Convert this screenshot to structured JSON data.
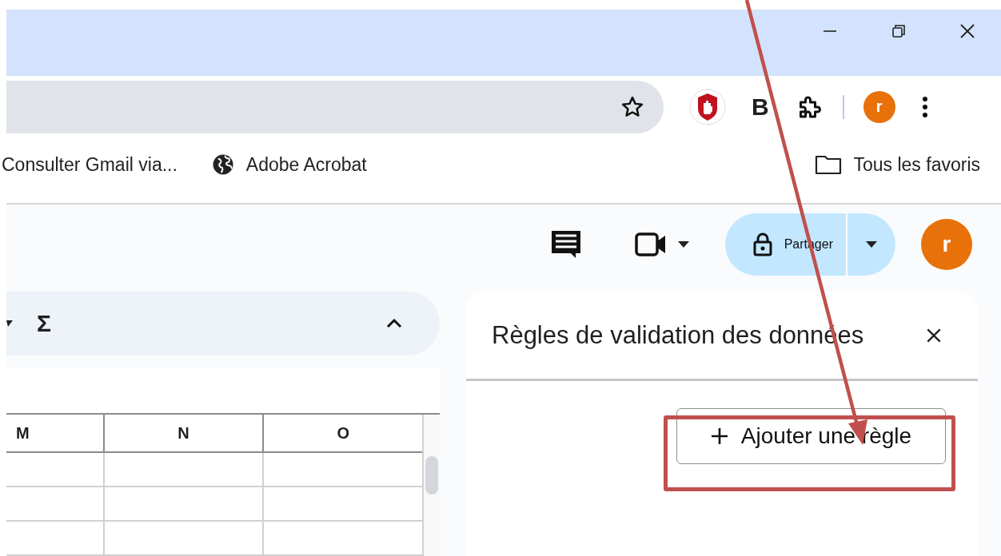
{
  "browser": {
    "extension_letter": "B",
    "profile_initial": "r"
  },
  "bookmarks": [
    {
      "kind": "page",
      "label": "Consulter Gmail via..."
    },
    {
      "kind": "site",
      "label": "Adobe Acrobat"
    },
    {
      "kind": "folder",
      "label": "Tous les favoris"
    }
  ],
  "app_header": {
    "share_label": "Partager",
    "avatar_initial": "r"
  },
  "toolbar": {
    "sum_symbol": "Σ"
  },
  "sheet": {
    "columns": [
      "M",
      "N",
      "O"
    ]
  },
  "panel": {
    "title": "Règles de validation des données",
    "add_button": "Ajouter une règle"
  },
  "annotation": {
    "highlight": true
  }
}
